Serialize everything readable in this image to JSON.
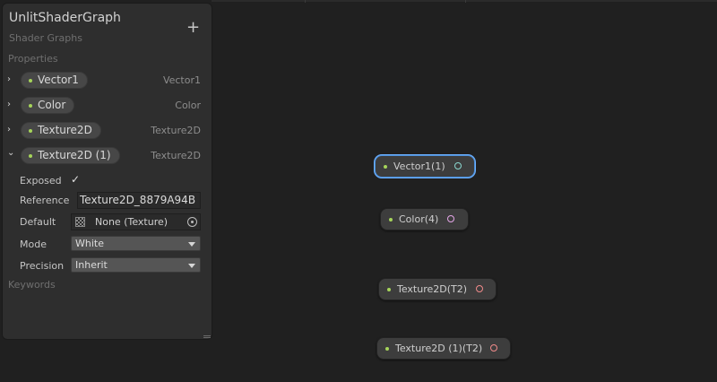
{
  "blackboard": {
    "title": "UnlitShaderGraph",
    "subtitle": "Shader Graphs",
    "add_label": "+",
    "properties_label": "Properties",
    "keywords_label": "Keywords",
    "properties": [
      {
        "name": "Vector1",
        "type": "Vector1",
        "expanded": false
      },
      {
        "name": "Color",
        "type": "Color",
        "expanded": false
      },
      {
        "name": "Texture2D",
        "type": "Texture2D",
        "expanded": false
      },
      {
        "name": "Texture2D (1)",
        "type": "Texture2D",
        "expanded": true
      }
    ],
    "expanded_fields": {
      "exposed_label": "Exposed",
      "exposed_checked": true,
      "checkmark": "✓",
      "reference_label": "Reference",
      "reference_value": "Texture2D_8879A94B",
      "default_label": "Default",
      "default_value": "None (Texture)",
      "mode_label": "Mode",
      "mode_value": "White",
      "precision_label": "Precision",
      "precision_value": "Inherit"
    },
    "arrow_collapsed": "›",
    "arrow_expanded": "⌄"
  },
  "nodes": [
    {
      "label": "Vector1(1)",
      "selected": true,
      "port_color": "#8ad8d0"
    },
    {
      "label": "Color(4)",
      "selected": false,
      "port_color": "#e5a6e8"
    },
    {
      "label": "Texture2D(T2)",
      "selected": false,
      "port_color": "#f08a8a"
    },
    {
      "label": "Texture2D (1)(T2)",
      "selected": false,
      "port_color": "#f08a8a"
    }
  ],
  "colors": {
    "background": "#202020",
    "panel": "#2e2e2e",
    "accent_green": "#a6d45a",
    "selection_blue": "#4d8fd8"
  }
}
